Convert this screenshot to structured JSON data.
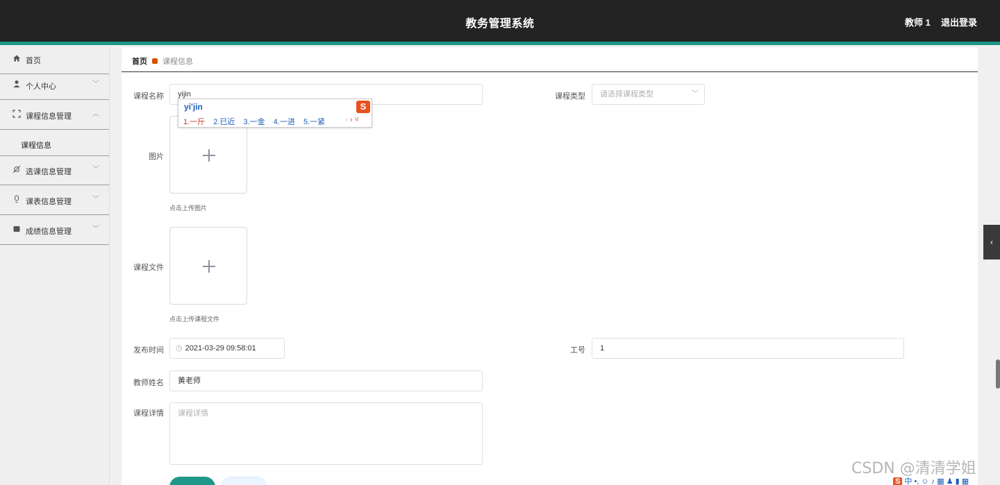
{
  "header": {
    "title": "教务管理系统",
    "user": "教师 1",
    "logout": "退出登录"
  },
  "sidebar": {
    "items": [
      {
        "label": "首页",
        "icon": "home-icon",
        "chevron": ""
      },
      {
        "label": "个人中心",
        "icon": "user-icon",
        "chevron": "﹀"
      },
      {
        "label": "课程信息管理",
        "icon": "frame-icon",
        "chevron": "︿"
      },
      {
        "label": "选课信息管理",
        "icon": "bell-off-icon",
        "chevron": "﹀"
      },
      {
        "label": "课表信息管理",
        "icon": "bulb-icon",
        "chevron": "﹀"
      },
      {
        "label": "成绩信息管理",
        "icon": "box-icon",
        "chevron": "﹀"
      }
    ],
    "sub_item": "课程信息"
  },
  "breadcrumb": {
    "home": "首页",
    "current": "课程信息"
  },
  "form": {
    "course_name_label": "课程名称",
    "course_name_value": "yijin",
    "course_type_label": "课程类型",
    "course_type_placeholder": "请选择课程类型",
    "image_label": "图片",
    "image_hint": "点击上传图片",
    "file_label": "课程文件",
    "file_hint": "点击上传课程文件",
    "publish_time_label": "发布时间",
    "publish_time_value": "2021-03-29 09:58:01",
    "work_id_label": "工号",
    "work_id_value": "1",
    "teacher_name_label": "教师姓名",
    "teacher_name_value": "黄老师",
    "detail_label": "课程详情",
    "detail_placeholder": "课程详情"
  },
  "ime": {
    "pinyin": "yi'jin",
    "candidates": [
      "1.一斤",
      "2.已近",
      "3.一金",
      "4.一进",
      "5.一紧"
    ],
    "logo": "S"
  },
  "watermark": "CSDN @清清学姐",
  "colors": {
    "header_bg": "#232323",
    "accent": "#1e9788",
    "sidebar_bg": "#efefef"
  }
}
